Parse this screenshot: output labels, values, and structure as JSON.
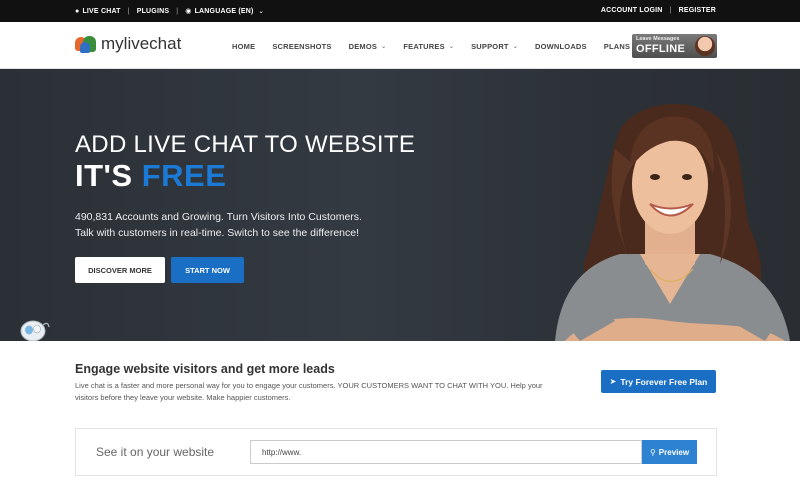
{
  "topbar": {
    "live_chat": "LIVE CHAT",
    "plugins": "PLUGINS",
    "language": "LANGUAGE (EN)",
    "account_login": "ACCOUNT LOGIN",
    "register": "REGISTER"
  },
  "header": {
    "logo_text": "mylivechat",
    "nav": [
      {
        "label": "HOME"
      },
      {
        "label": "SCREENSHOTS"
      },
      {
        "label": "DEMOS"
      },
      {
        "label": "FEATURES"
      },
      {
        "label": "SUPPORT"
      },
      {
        "label": "DOWNLOADS"
      },
      {
        "label": "PLANS"
      }
    ],
    "offline_badge": {
      "small": "Leave Messages",
      "big": "OFFLINE"
    }
  },
  "hero": {
    "title_line1": "ADD LIVE CHAT TO WEBSITE",
    "title_its": "IT'S ",
    "title_free": "FREE",
    "desc_line1": "490,831 Accounts and Growing. Turn Visitors Into Customers.",
    "desc_line2": "Talk with customers in real-time. Switch to see the difference!",
    "discover_label": "DISCOVER MORE",
    "start_label": "START NOW"
  },
  "engage": {
    "title": "Engage website visitors and get more leads",
    "text": "Live chat is a faster and more personal way for you to engage your customers. YOUR CUSTOMERS WANT TO CHAT WITH YOU. Help your visitors before they leave your website. Make happier customers.",
    "cta_label": "Try Forever Free Plan"
  },
  "preview": {
    "label": "See it on your website",
    "input_value": "http://www.",
    "button_label": "Preview"
  },
  "colors": {
    "accent": "#1a6fc4",
    "free_text": "#1a7ad6",
    "topbar_bg": "#111111",
    "hero_bg": "#30353c"
  }
}
